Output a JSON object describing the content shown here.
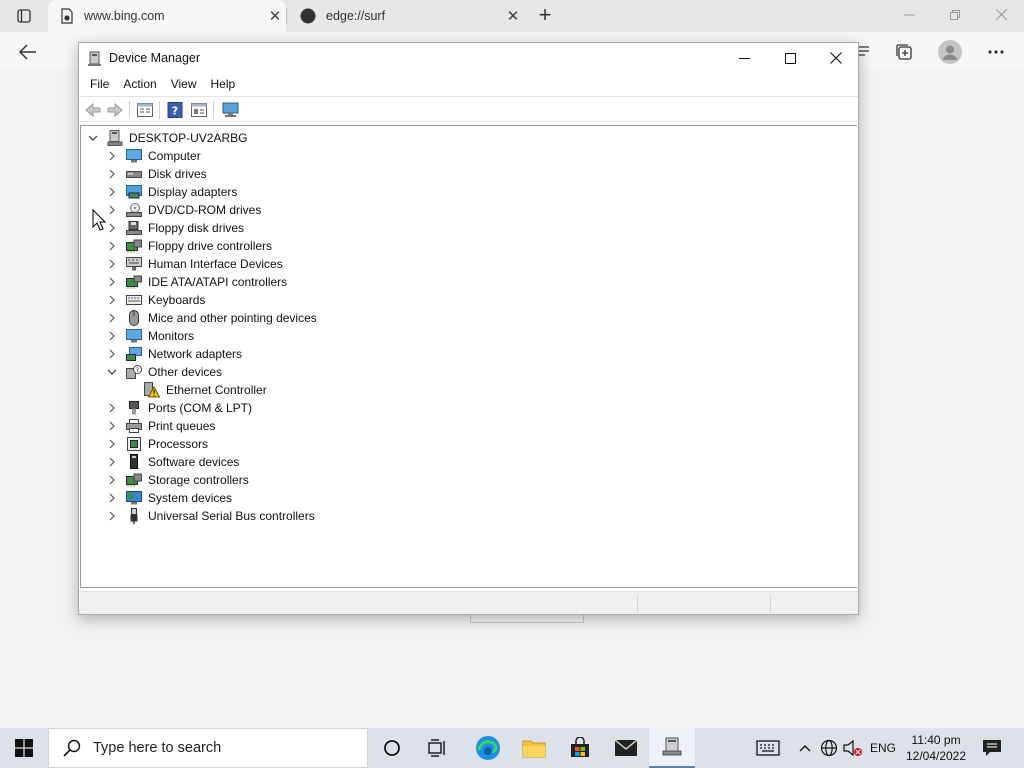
{
  "browser": {
    "tabs": [
      {
        "title": "www.bing.com",
        "active": true
      },
      {
        "title": "edge://surf",
        "active": false
      }
    ],
    "new_tab_symbol": "+",
    "close_symbol": "✕"
  },
  "device_manager": {
    "title": "Device Manager",
    "menu": [
      "File",
      "Action",
      "View",
      "Help"
    ],
    "root": "DESKTOP-UV2ARBG",
    "categories": [
      {
        "label": "Computer",
        "icon": "computer-icon",
        "expanded": false
      },
      {
        "label": "Disk drives",
        "icon": "disk-drive-icon",
        "expanded": false
      },
      {
        "label": "Display adapters",
        "icon": "display-adapter-icon",
        "expanded": false
      },
      {
        "label": "DVD/CD-ROM drives",
        "icon": "dvd-drive-icon",
        "expanded": false
      },
      {
        "label": "Floppy disk drives",
        "icon": "floppy-disk-icon",
        "expanded": false
      },
      {
        "label": "Floppy drive controllers",
        "icon": "floppy-controller-icon",
        "expanded": false
      },
      {
        "label": "Human Interface Devices",
        "icon": "hid-icon",
        "expanded": false
      },
      {
        "label": "IDE ATA/ATAPI controllers",
        "icon": "ide-controller-icon",
        "expanded": false
      },
      {
        "label": "Keyboards",
        "icon": "keyboard-icon",
        "expanded": false
      },
      {
        "label": "Mice and other pointing devices",
        "icon": "mouse-icon",
        "expanded": false
      },
      {
        "label": "Monitors",
        "icon": "monitor-icon",
        "expanded": false
      },
      {
        "label": "Network adapters",
        "icon": "network-adapter-icon",
        "expanded": false
      },
      {
        "label": "Other devices",
        "icon": "unknown-device-icon",
        "expanded": true,
        "children": [
          {
            "label": "Ethernet Controller",
            "icon": "warning-device-icon"
          }
        ]
      },
      {
        "label": "Ports (COM & LPT)",
        "icon": "port-icon",
        "expanded": false
      },
      {
        "label": "Print queues",
        "icon": "printer-icon",
        "expanded": false
      },
      {
        "label": "Processors",
        "icon": "processor-icon",
        "expanded": false
      },
      {
        "label": "Software devices",
        "icon": "software-device-icon",
        "expanded": false
      },
      {
        "label": "Storage controllers",
        "icon": "storage-controller-icon",
        "expanded": false
      },
      {
        "label": "System devices",
        "icon": "system-device-icon",
        "expanded": false
      },
      {
        "label": "Universal Serial Bus controllers",
        "icon": "usb-icon",
        "expanded": false
      }
    ]
  },
  "taskbar": {
    "search_placeholder": "Type here to search",
    "language": "ENG",
    "time": "11:40 pm",
    "date": "12/04/2022"
  }
}
